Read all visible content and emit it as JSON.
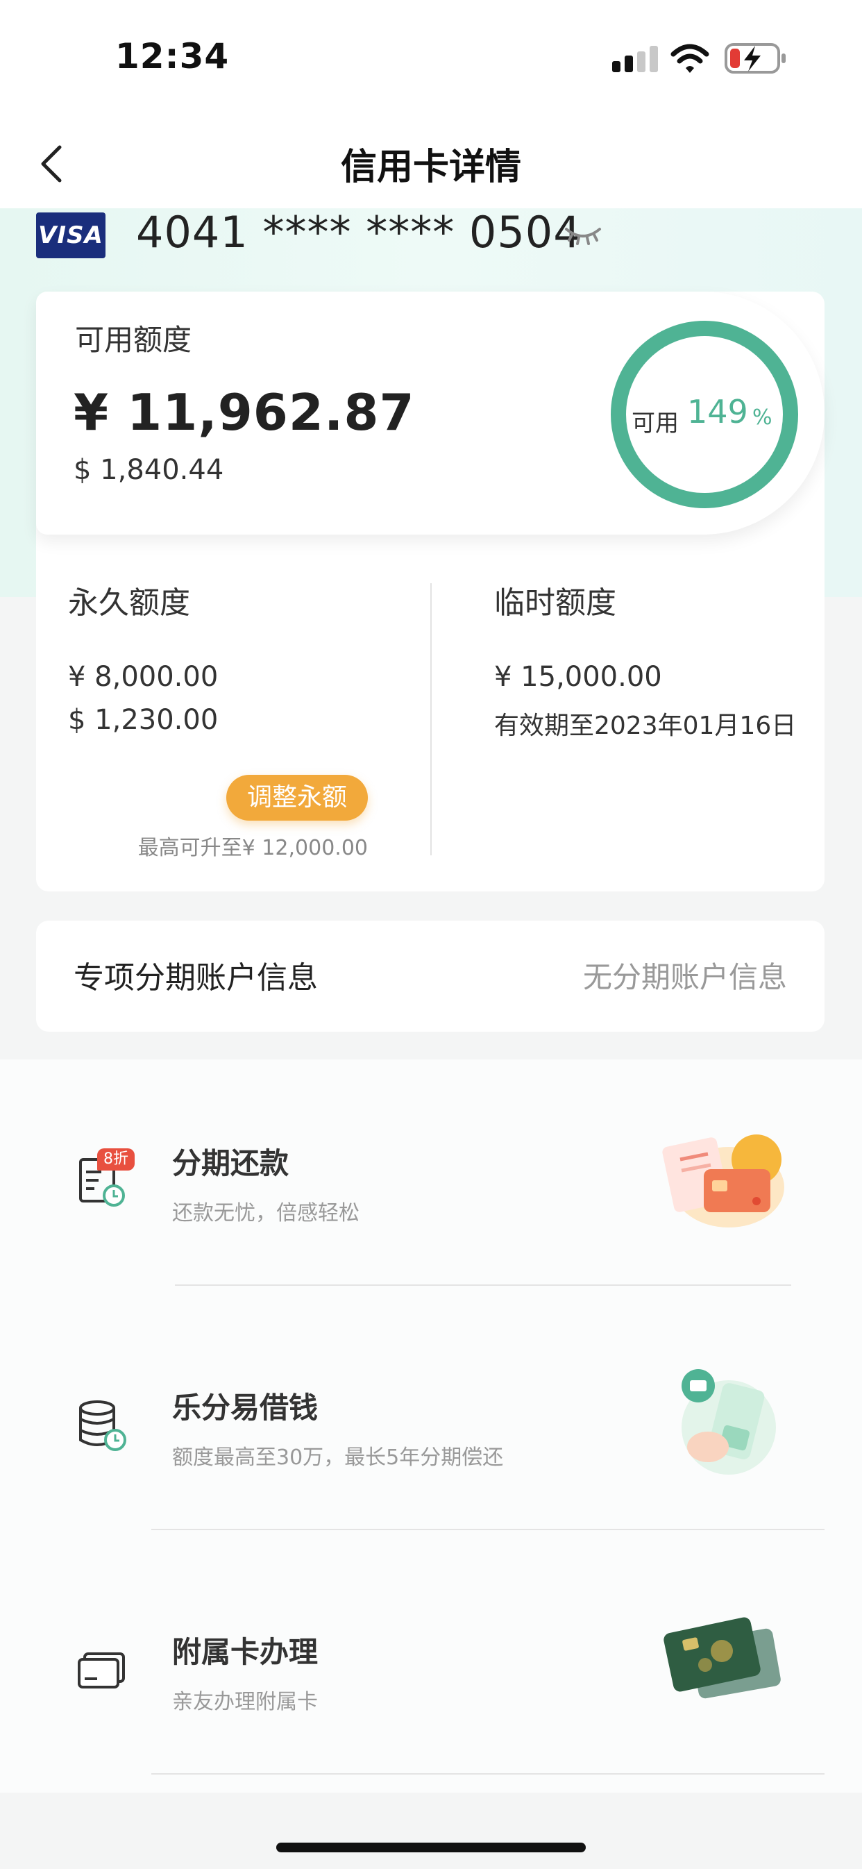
{
  "status_bar": {
    "time": "12:34"
  },
  "nav": {
    "title": "信用卡详情"
  },
  "card": {
    "brand": "VISA",
    "number": "4041 **** **** 0504"
  },
  "available": {
    "label": "可用额度",
    "amount_cny": "¥ 11,962.87",
    "amount_usd": "$ 1,840.44",
    "ring_label": "可用",
    "ring_percent": "149",
    "ring_percent_unit": "%",
    "ring_fill_fraction": 1.0
  },
  "permanent": {
    "title": "永久额度",
    "amount_cny": "¥ 8,000.00",
    "amount_usd": "$ 1,230.00",
    "adjust_button": "调整永额",
    "max_note": "最高可升至¥ 12,000.00"
  },
  "temporary": {
    "title": "临时额度",
    "amount_cny": "¥ 15,000.00",
    "valid_until": "有效期至2023年01月16日"
  },
  "installment_account": {
    "title": "专项分期账户信息",
    "value": "无分期账户信息"
  },
  "services": [
    {
      "title": "分期还款",
      "subtitle": "还款无忧，倍感轻松",
      "badge": "8折",
      "icon": "bill-clock-icon"
    },
    {
      "title": "乐分易借钱",
      "subtitle": "额度最高至30万，最长5年分期偿还",
      "icon": "coins-clock-icon"
    },
    {
      "title": "附属卡办理",
      "subtitle": "亲友办理附属卡",
      "icon": "cards-icon"
    }
  ],
  "colors": {
    "accent_green": "#4fb394",
    "orange": "#f2a93b",
    "visa_blue": "#1a2e7c"
  }
}
